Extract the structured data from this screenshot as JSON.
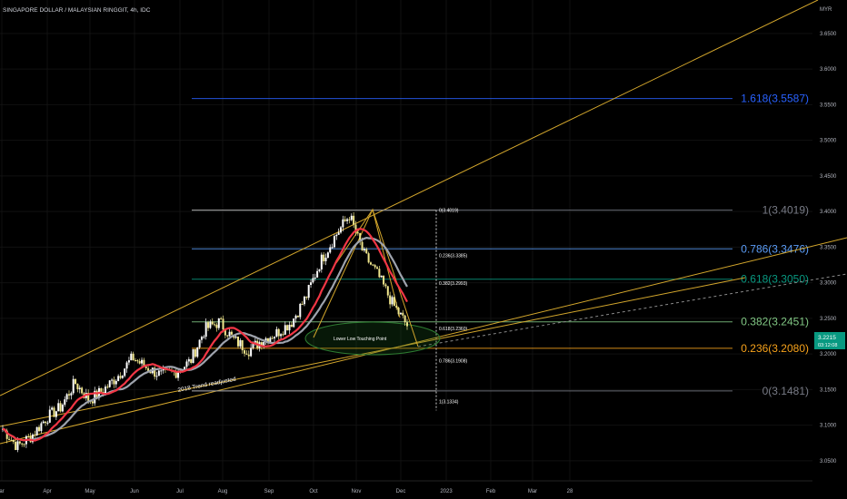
{
  "header": {
    "title": "SINGAPORE DOLLAR / MALAYSIAN RINGGIT, 4h, IDC"
  },
  "price_axis": {
    "currency": "MYR",
    "ticks": [
      "3.6500",
      "3.6000",
      "3.5500",
      "3.5000",
      "3.4500",
      "3.4000",
      "3.3500",
      "3.3000",
      "3.2500",
      "3.2000",
      "3.1500",
      "3.1000",
      "3.0500"
    ],
    "current_price": "3.2215",
    "countdown": "03:12:08"
  },
  "time_axis": {
    "labels": [
      "ar",
      "Apr",
      "May",
      "Jun",
      "Jul",
      "Aug",
      "Sep",
      "Oct",
      "Nov",
      "Dec",
      "2023",
      "Feb",
      "Mar",
      "28"
    ]
  },
  "fib_large": [
    {
      "label": "1.618(3.5587)",
      "price": 3.5587,
      "color": "#2962ff"
    },
    {
      "label": "1(3.4019)",
      "price": 3.4019,
      "color": "#787b86"
    },
    {
      "label": "0.786(3.3476)",
      "price": 3.3476,
      "color": "#5b9cf6"
    },
    {
      "label": "0.618(3.3050)",
      "price": 3.305,
      "color": "#089981"
    },
    {
      "label": "0.382(3.2451)",
      "price": 3.2451,
      "color": "#81c784"
    },
    {
      "label": "0.236(3.2080)",
      "price": 3.208,
      "color": "#f7a21b"
    },
    {
      "label": "0(3.1481)",
      "price": 3.1481,
      "color": "#787b86"
    }
  ],
  "fib_small": [
    {
      "label": "0(3.4019)",
      "price": 3.4019
    },
    {
      "label": "0.236(3.3385)",
      "price": 3.3385
    },
    {
      "label": "0.382(3.2993)",
      "price": 3.2993
    },
    {
      "label": "0.618(3.2360)",
      "price": 3.236
    },
    {
      "label": "0.786(3.1908)",
      "price": 3.1908
    },
    {
      "label": "1(3.1334)",
      "price": 3.1334
    }
  ],
  "annotations": {
    "ellipse_label": "Lower Low Touching Point",
    "trend_label": "2018 Trend readjusted"
  },
  "colors": {
    "up": "#ffffff",
    "down": "#f0e68c",
    "ma_red": "#f23645",
    "ma_gray": "#9ea3ad",
    "trendline": "#d4a72c",
    "ellipse": "#2e7d32",
    "ellipse_fill": "#1b5e20",
    "price_tag": "#089981"
  },
  "chart_data": {
    "type": "candlestick",
    "title": "SINGAPORE DOLLAR / MALAYSIAN RINGGIT, 4h, IDC",
    "ylabel": "MYR",
    "ylim": [
      3.02,
      3.68
    ],
    "x_labels": [
      "ar",
      "Apr",
      "May",
      "Jun",
      "Jul",
      "Aug",
      "Sep",
      "Oct",
      "Nov",
      "Dec",
      "2023",
      "Feb",
      "Mar",
      "28"
    ],
    "price_path": [
      [
        "Mar",
        3.095
      ],
      [
        "Mar",
        3.07
      ],
      [
        "Apr",
        3.085
      ],
      [
        "Apr",
        3.11
      ],
      [
        "Apr",
        3.125
      ],
      [
        "May",
        3.16
      ],
      [
        "May",
        3.135
      ],
      [
        "May",
        3.15
      ],
      [
        "Jun",
        3.17
      ],
      [
        "Jun",
        3.195
      ],
      [
        "Jun",
        3.18
      ],
      [
        "Jul",
        3.17
      ],
      [
        "Jul",
        3.175
      ],
      [
        "Jul",
        3.19
      ],
      [
        "Aug",
        3.235
      ],
      [
        "Aug",
        3.245
      ],
      [
        "Aug",
        3.22
      ],
      [
        "Sep",
        3.205
      ],
      [
        "Sep",
        3.22
      ],
      [
        "Oct",
        3.23
      ],
      [
        "Oct",
        3.245
      ],
      [
        "Oct",
        3.28
      ],
      [
        "Oct",
        3.33
      ],
      [
        "Nov",
        3.365
      ],
      [
        "Nov",
        3.395
      ],
      [
        "Nov",
        3.34
      ],
      [
        "Nov",
        3.31
      ],
      [
        "Dec",
        3.27
      ],
      [
        "Dec",
        3.24
      ]
    ],
    "last_price": 3.2215
  }
}
